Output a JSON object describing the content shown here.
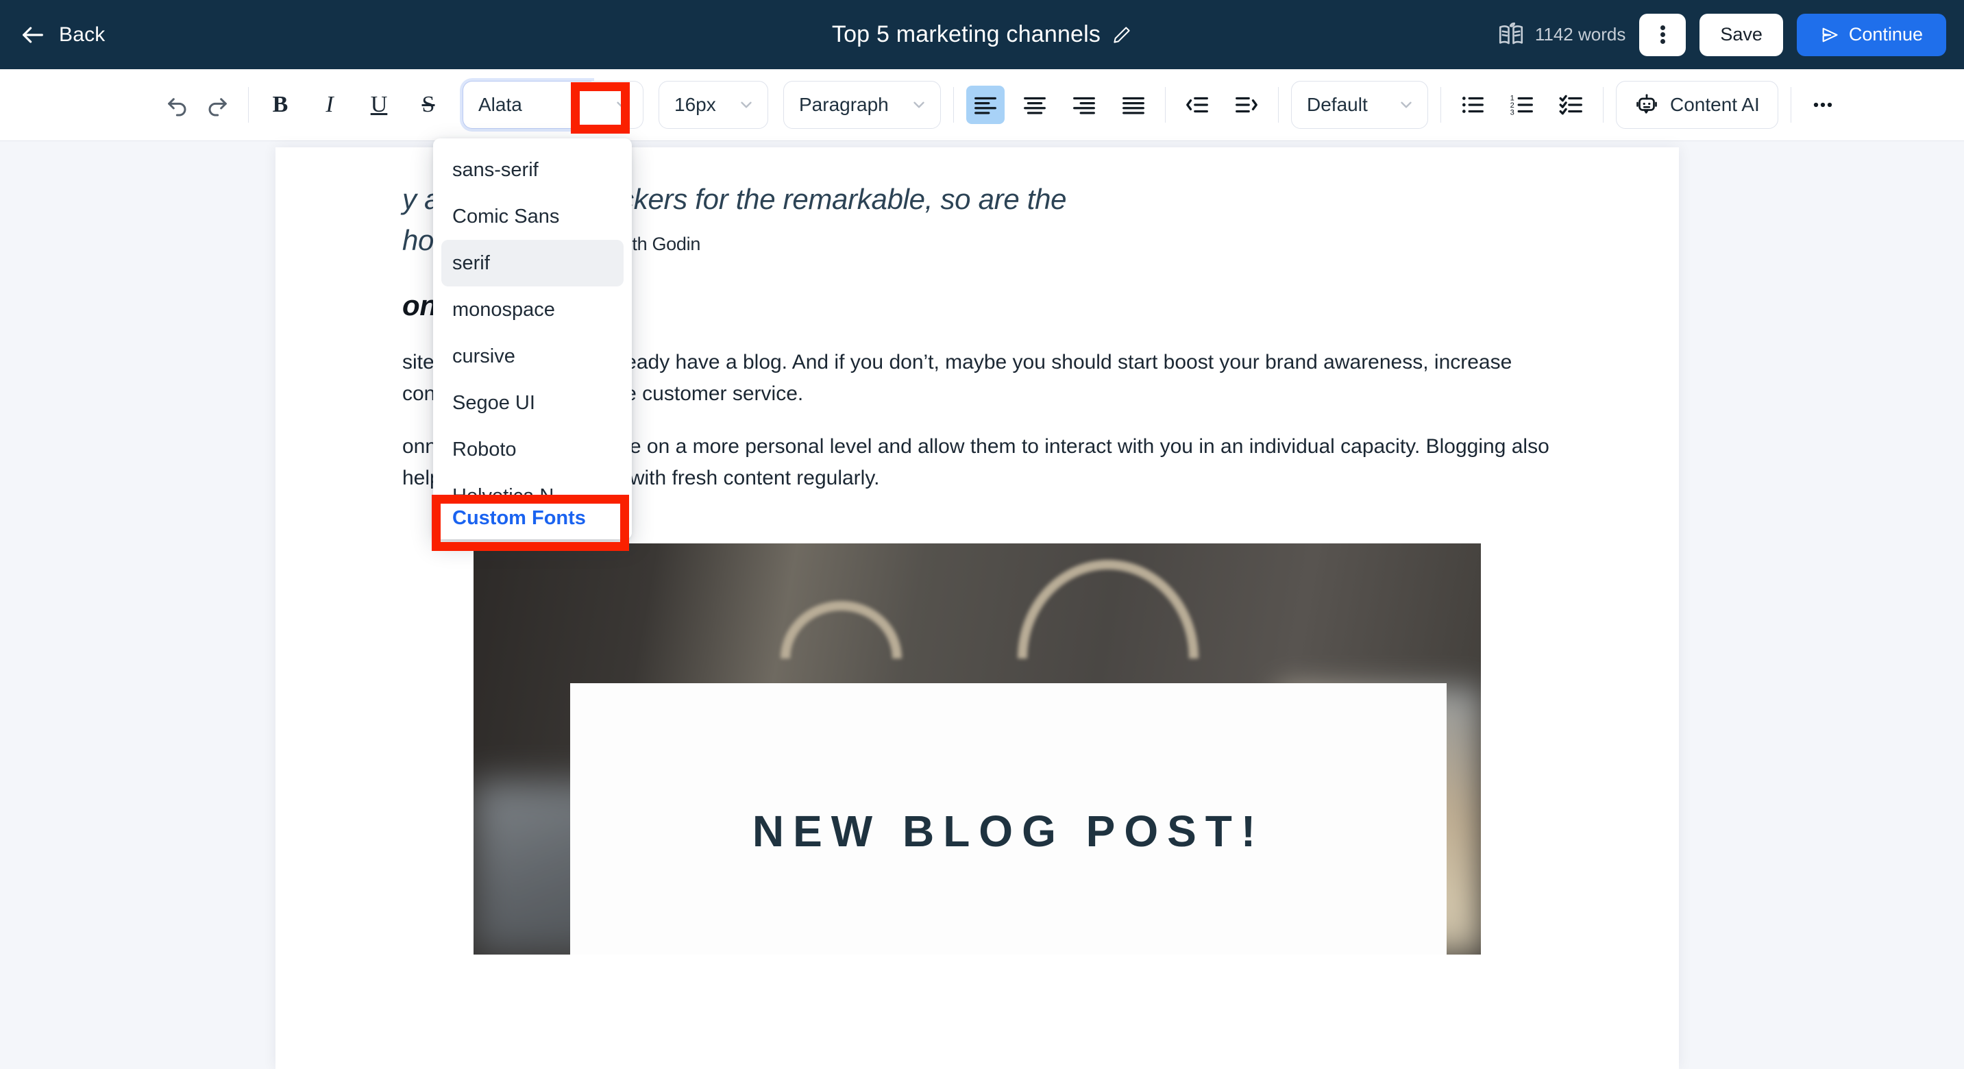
{
  "header": {
    "back_label": "Back",
    "back_icon": "arrow-left-icon",
    "title": "Top 5 marketing channels",
    "edit_icon": "pencil-icon",
    "book_icon": "book-icon",
    "word_count": "1142 words",
    "more_icon": "kebab-menu-icon",
    "save_label": "Save",
    "continue_label": "Continue",
    "continue_icon": "send-icon",
    "accent_color": "#1f6feb",
    "bar_color": "#123047"
  },
  "toolbar": {
    "undo_icon": "undo-icon",
    "redo_icon": "redo-icon",
    "bold_label": "B",
    "italic_label": "I",
    "underline_label": "U",
    "strikethrough_label": "S",
    "font_family_value": "Alata",
    "font_size_value": "16px",
    "block_type_value": "Paragraph",
    "line_height_value": "Default",
    "align_left_icon": "align-left-icon",
    "align_center_icon": "align-center-icon",
    "align_right_icon": "align-right-icon",
    "align_justify_icon": "align-justify-icon",
    "outdent_icon": "outdent-icon",
    "indent_icon": "indent-icon",
    "bullet_list_icon": "bullet-list-icon",
    "numbered_list_icon": "numbered-list-icon",
    "checklist_icon": "checklist-icon",
    "content_ai_label": "Content AI",
    "content_ai_icon": "robot-icon",
    "overflow_icon": "ellipsis-icon",
    "active_alignment": "align-left"
  },
  "font_dropdown": {
    "items": [
      {
        "label": "sans-serif",
        "selected": false
      },
      {
        "label": "Comic Sans",
        "selected": false
      },
      {
        "label": "serif",
        "selected": true
      },
      {
        "label": "monospace",
        "selected": false
      },
      {
        "label": "cursive",
        "selected": false
      },
      {
        "label": "Segoe UI",
        "selected": false
      },
      {
        "label": "Roboto",
        "selected": false
      },
      {
        "label": "Helvetica N",
        "selected": false
      }
    ],
    "footer_label": "Custom Fonts",
    "footer_color": "#1a63f0"
  },
  "annotations": {
    "box_color": "#fa2000",
    "boxes": [
      {
        "name": "font-family-dropdown-arrow"
      },
      {
        "name": "custom-fonts-option"
      }
    ]
  },
  "document": {
    "quote_line1": "y are bloggers suckers for the remarkable, so are the",
    "quote_line2": "ho read blogs .”",
    "quote_author": "- Seth Godin",
    "heading": "on:",
    "paragraph1": "site, chances are you already have a blog. And if you don’t, maybe you should start boost your brand awareness, increase conversions, and improve customer service.",
    "paragraph2": "onnect with your audience on a more personal level and allow them to interact with you in an individual capacity. Blogging also helps to present viewers with fresh content regularly.",
    "image_caption": "NEW BLOG POST!"
  }
}
